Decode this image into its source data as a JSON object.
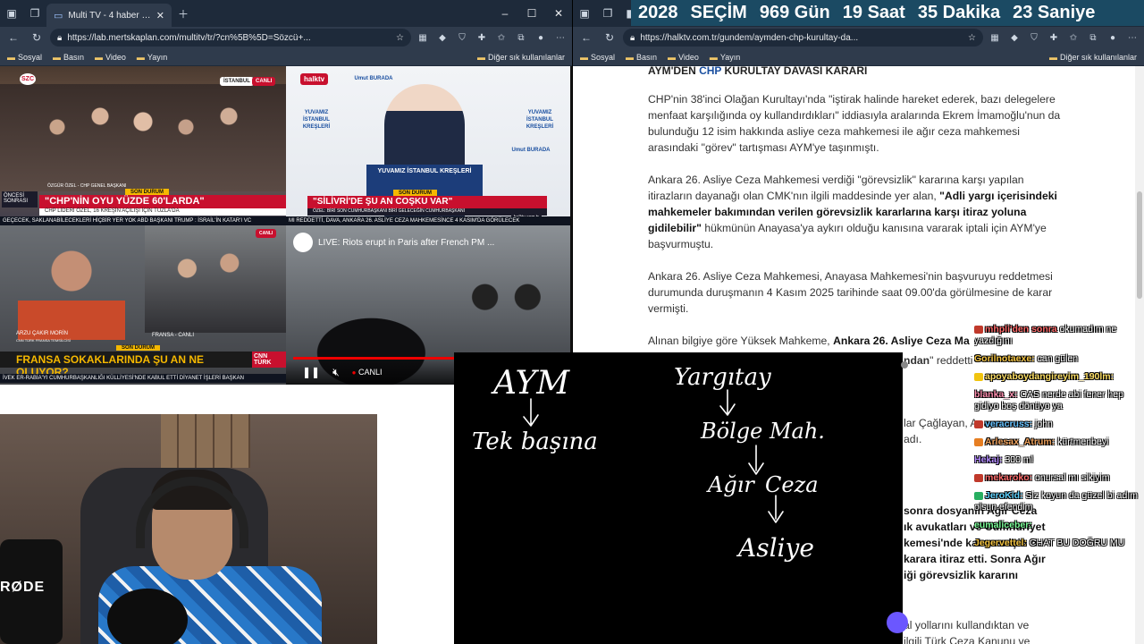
{
  "left_window": {
    "tab_title": "Multi TV - 4 haber kanalını a",
    "url": "https://lab.mertskaplan.com/multitv/tr/?cn%5B%5D=Sözcü+...",
    "bookmarks": [
      "Sosyal",
      "Basın",
      "Video",
      "Yayın"
    ],
    "other_bookmarks": "Diğer sık kullanılanlar"
  },
  "right_window": {
    "url": "https://halktv.com.tr/gundem/aymden-chp-kurultay-da...",
    "bookmarks": [
      "Sosyal",
      "Basın",
      "Video",
      "Yayın"
    ],
    "other_bookmarks": "Diğer sık kullanılanlar"
  },
  "countdown": {
    "year": "2028",
    "label": "SEÇİM",
    "days": "969 Gün",
    "hours": "19 Saat",
    "minutes": "35 Dakika",
    "seconds": "23 Saniye"
  },
  "tiles": {
    "szc": {
      "logo": "SZC",
      "tag_left": "İSTANBUL",
      "tag_right": "CANLI",
      "label_small": "ÖNCESİ SONRASI",
      "speaker": "ÖZGÜR ÖZEL - CHP GENEL BAŞKANI",
      "son_durum": "SON DURUM",
      "headline": "\"CHP'NİN OYU YÜZDE 60'LARDA\"",
      "subline": "CHP LİDERİ ÖZEL, 16 KREŞİN AÇILIŞI İÇİN TUZLA'DA",
      "ticker": "GEÇECEK, SAKLANABİLECEKLERİ HİÇBİR YER YOK   ABD BAŞKANI TRUMP : İSRAİL'İN KATAR'I VC"
    },
    "halk": {
      "logo": "halktv",
      "brand_lines": [
        "YUVAMIZ İSTANBUL",
        "KREŞLERİ"
      ],
      "brand_small": "Umut BURADA",
      "podium": "YUVAMIZ İSTANBUL KREŞLERİ",
      "son_durum": "SON DURUM",
      "headline": "\"SİLİVRİ'DE ŞU AN COŞKU VAR\"",
      "subline": "ÖZEL: BİRİ SON CUMHURBAŞKANI BİRİ GELECEĞİN CUMHURBAŞKANI",
      "ticker": "MI REDDETTİ, DAVA, ANKARA 26. ASLİYE CEZA MAHKEMESİNCE 4 KASIM'DA GÖRÜLECEK",
      "site": "halktv.com.tr"
    },
    "cnn": {
      "tag": "CANLI",
      "reporter": "ARZU ÇAKIR MORİN",
      "reporter_title": "CNN TÜRK FRANSA TEMSİLCİSİ",
      "place": "FRANSA - CANLI",
      "son_durum": "SON DURUM",
      "headline": "FRANSA SOKAKLARINDA ŞU AN NE OLUYOR?",
      "logo": "CNN TÜRK",
      "ticker": "İVEK ER-RABİA'YI CUMHURBAŞKANLIĞI KÜLLİYESİ'NDE KABUL ETTİ   DİYANET İŞLERİ BAŞKAN"
    },
    "yt": {
      "title": "LIVE: Riots erupt in Paris after French PM ...",
      "live_label": "CANLI"
    }
  },
  "article": {
    "heading_prefix": "AYM'DEN ",
    "heading_chp": "CHP",
    "heading_suffix": " KURULTAY DAVASI KARARI",
    "p1": "CHP'nin 38'inci Olağan Kurultayı'nda \"iştirak halinde hareket ederek, bazı delegelere menfaat karşılığında oy kullandırdıkları\" iddiasıyla aralarında Ekrem İmamoğlu'nun da bulunduğu 12 isim hakkında asliye ceza mahkemesi ile ağır ceza mahkemesi arasındaki \"görev\" tartışması AYM'ye taşınmıştı.",
    "p2_a": "Ankara 26. Asliye Ceza Mahkemesi verdiği \"görevsizlik\" kararına karşı yapılan itirazların dayanağı olan CMK'nın ilgili maddesinde yer alan, ",
    "p2_b": "\"Adli yargı içerisindeki mahkemeler bakımından verilen görevsizlik kararlarına karşı itiraz yoluna gidilebilir\"",
    "p2_c": " hükmünün Anayasa'ya aykırı olduğu kanısına vararak iptali için AYM'ye başvurmuştu.",
    "p3": "Ankara 26. Asliye Ceza Mahkemesi, Anayasa Mahkemesi'nin başvuruyu reddetmesi durumunda duruşmanın 4 Kasım 2025 tarihinde saat 09.00'da görülmesine de karar vermişti.",
    "p4_a": "Alınan bilgiye göre Yüksek Mahkeme, ",
    "p4_b": "Ankara 26. Asliye Ceza Ma",
    "p4_c": "ndan",
    "p4_d": "\" reddetti",
    "frag1": "lar Çağlayan, Anayasa",
    "frag2": "adı.",
    "frag3": "sonra dosyanın Ağır Ceza",
    "frag4": "ık avukatları ve Cumhuriyet",
    "frag5": "kemesi'nde kalması için bu",
    "frag6": "karara itiraz etti. Sonra Ağır",
    "frag7": "iği görevsizlik kararını",
    "frag8": "al yollarını kullandıktan ve",
    "frag9": "ilgili Türk Ceza Kanunu ve"
  },
  "whiteboard": {
    "left_word": "AYM",
    "left_under": "Tek başına",
    "right_top": "Yargıtay",
    "right_mid": "Bölge Mah.",
    "right_low1": "Ağır",
    "right_low2": "Ceza",
    "right_bottom": "Asliye"
  },
  "chat": [
    {
      "user": "mhpli'den sonra",
      "text": "okumadım ne yazdığını",
      "color": "#ff6b6b",
      "badge": "#c0392b"
    },
    {
      "user": "Gorilnotaexe:",
      "text": "can gülen",
      "color": "#f5c542",
      "badge": ""
    },
    {
      "user": "apoyaboydangireyim_190lm:",
      "text": "",
      "color": "#ffe066",
      "badge": "#f1c40f"
    },
    {
      "user": "blanka_x:",
      "text": "CAS nerde abi fener hep gidiyo boş dönüyo ya",
      "color": "#ff8fb0",
      "badge": ""
    },
    {
      "user": "veracruss:",
      "text": "john",
      "color": "#66c2ff",
      "badge": "#c0392b"
    },
    {
      "user": "Arlesax_Atrum:",
      "text": "kürtmenbeyi",
      "color": "#f0a35e",
      "badge": "#e67e22"
    },
    {
      "user": "Hekaj:",
      "text": "300 ml",
      "color": "#b48cff",
      "badge": ""
    },
    {
      "user": "mekaroko:",
      "text": "onursal mı sikiyim",
      "color": "#ff6b6b",
      "badge": "#c0392b"
    },
    {
      "user": "JeroKid:",
      "text": "Siz koyun da güzel bi adım olsun efendim",
      "color": "#5fd3ff",
      "badge": "#27ae60"
    },
    {
      "user": "eumaliceber:",
      "text": "",
      "color": "#7dff9a",
      "badge": ""
    },
    {
      "user": "Jegervettel:",
      "text": "CHAT BU DOĞRU MU",
      "color": "#f5c542",
      "badge": ""
    }
  ]
}
